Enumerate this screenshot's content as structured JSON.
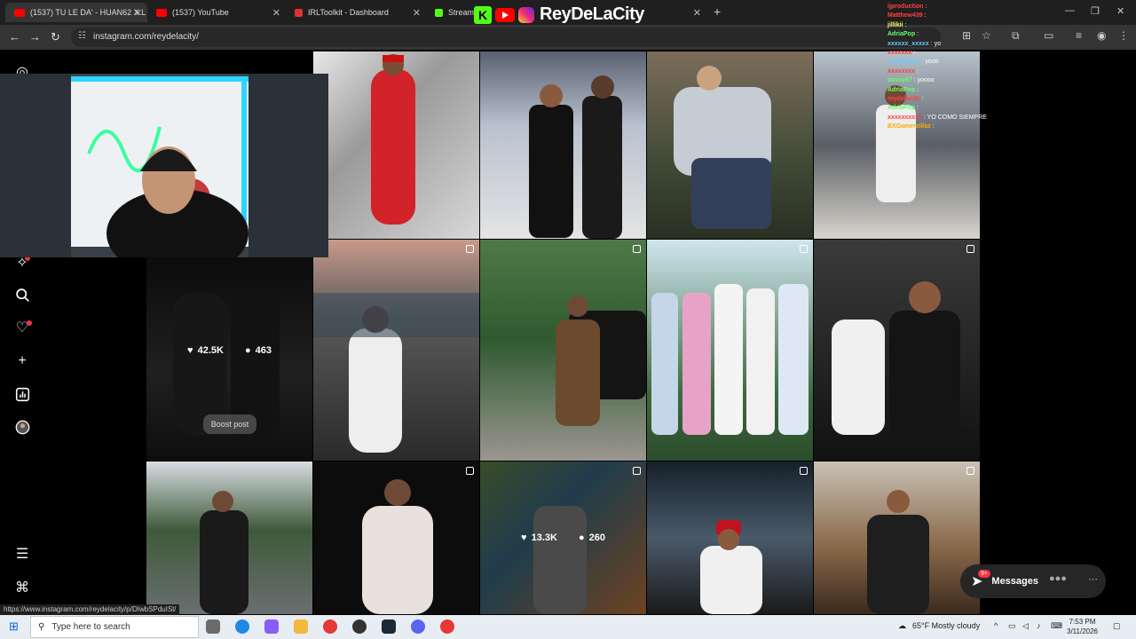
{
  "browser": {
    "tabs": [
      {
        "title": "(1537) TU LE DA' - HUAN62 X L",
        "color": "#ff0000"
      },
      {
        "title": "(1537) YouTube",
        "color": "#ff0000"
      },
      {
        "title": "IRLToolkit - Dashboard",
        "color": "#e03030"
      },
      {
        "title": "Stream",
        "color": "#53fc18"
      }
    ],
    "url": "instagram.com/reydelacity/",
    "status_url": "https://www.instagram.com/reydelacity/p/DIwbSPduISl/"
  },
  "overlay_brand": {
    "name": "ReyDeLaCity",
    "kick_letter": "K"
  },
  "chat": [
    {
      "user": "ijproduction",
      "msg": "",
      "color": "#ff4040"
    },
    {
      "user": "Matthew439",
      "msg": "",
      "color": "#ff4040"
    },
    {
      "user": "jillikii",
      "msg": "",
      "color": "#ffff66"
    },
    {
      "user": "AdriaPop",
      "msg": "",
      "color": "#66ff66"
    },
    {
      "user": "xxxxxx_xxxxx",
      "msg": "yo",
      "color": "#66ccff"
    },
    {
      "user": "xxxxxxx",
      "msg": "",
      "color": "#ff4040"
    },
    {
      "user": "Jeankokoo",
      "msg": "yooo",
      "color": "#66ccff"
    },
    {
      "user": "xxxxxxxx",
      "msg": "",
      "color": "#ff4040"
    },
    {
      "user": "dxvay97",
      "msg": "yoooo",
      "color": "#66ff66"
    },
    {
      "user": "AdriaPop",
      "msg": "",
      "color": "#66ff66"
    },
    {
      "user": "reydelacity",
      "msg": "",
      "color": "#ff4040"
    },
    {
      "user": "AdriaPop",
      "msg": "",
      "color": "#66ff66"
    },
    {
      "user": "xxxxxxxxxx",
      "msg": "YO COMO SIEMPRE",
      "color": "#ff4040"
    },
    {
      "user": "BXGamerzillaz",
      "msg": "",
      "color": "#ffaa00"
    }
  ],
  "grid": {
    "hover_post": {
      "likes": "42.5K",
      "comments": "463",
      "boost_label": "Boost post"
    },
    "hover_post_2": {
      "likes": "13.3K",
      "comments": "260"
    }
  },
  "messages": {
    "label": "Messages",
    "badge": "9+"
  },
  "taskbar": {
    "search_placeholder": "Type here to search",
    "weather": "65°F  Mostly cloudy",
    "time": "7:53 PM",
    "date": "3/11/2026"
  },
  "colors": {
    "accent": "#ff3040",
    "bg": "#000000",
    "chrome_dark": "#1f1f1f"
  }
}
